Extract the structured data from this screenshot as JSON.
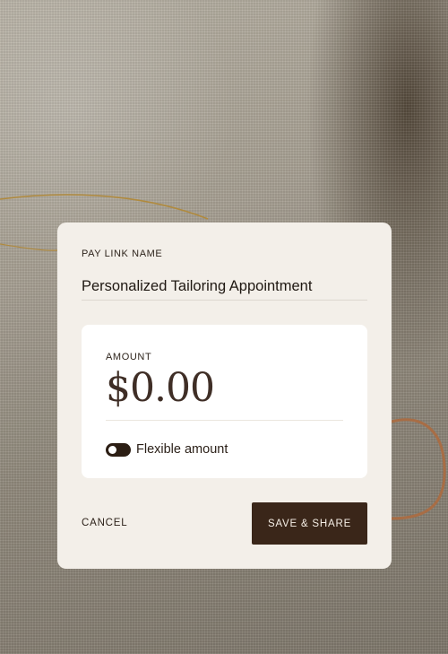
{
  "form": {
    "pay_link_name_label": "PAY LINK NAME",
    "pay_link_name_value": "Personalized Tailoring Appointment",
    "amount_label": "AMOUNT",
    "amount_value": "$0.00",
    "flexible_amount_label": "Flexible amount",
    "flexible_amount_enabled": true
  },
  "actions": {
    "cancel_label": "CANCEL",
    "save_label": "SAVE & SHARE"
  },
  "colors": {
    "card_background": "#f3efe9",
    "primary_button": "#3a2619",
    "text_dark": "#1f1812",
    "amount_text": "#3f2e26"
  }
}
